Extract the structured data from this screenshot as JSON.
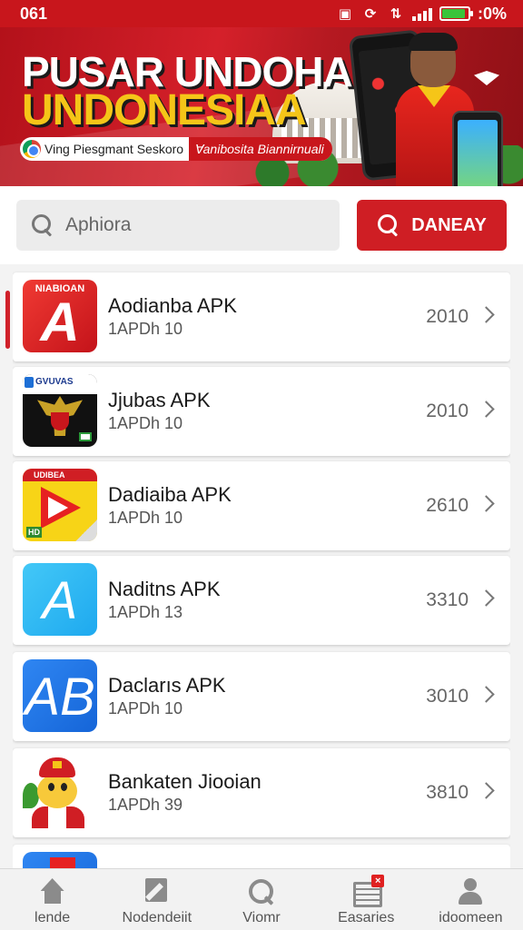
{
  "colors": {
    "brand_red": "#c8161c",
    "button_red": "#cf1e24",
    "battery_green": "#3ac43a",
    "banner_title_yellow": "#f5c518"
  },
  "status_bar": {
    "time": "061",
    "battery_text": ":0%",
    "battery_level": 0.9,
    "icons": [
      "notification-icon",
      "sync-icon",
      "data-icon",
      "signal-icon",
      "battery-icon"
    ]
  },
  "banner": {
    "title_line1": "PUSAR UNDOHAN",
    "title_line2": "UNDONESIAA",
    "subtitle_left": "Ving Piesgmant Seskoro",
    "subtitle_right": "ꓯanibosita Biannirnuali"
  },
  "search": {
    "placeholder": "Aphiora",
    "button_label": "DANEAY"
  },
  "apps": [
    {
      "name": "Aodianba APK",
      "meta": "1APDh 10",
      "size": "2010",
      "icon": "red-a-icon",
      "icon_title": "NIABIOAN",
      "glyph": "A"
    },
    {
      "name": "Jjubas APK",
      "meta": "1APDh 10",
      "size": "2010",
      "icon": "eagle-emblem-icon",
      "icon_title": "GVUVAS"
    },
    {
      "name": "Dadiaiba APK",
      "meta": "1APDh 10",
      "size": "2610",
      "icon": "play-icon",
      "icon_title": "UDIBEA",
      "icon_badge": "HD"
    },
    {
      "name": "Naditns APK",
      "meta": "1APDh 13",
      "size": "3310",
      "icon": "cyan-a-icon",
      "glyph": "A"
    },
    {
      "name": "Daclarıs APK",
      "meta": "1APDh 10",
      "size": "3010",
      "icon": "blue-ab-icon",
      "glyph": "AB"
    },
    {
      "name": "Bankaten Jiooian",
      "meta": "1APDh 39",
      "size": "3810",
      "icon": "mascot-icon"
    }
  ],
  "bottom_nav": [
    {
      "label": "lende",
      "icon": "home-icon"
    },
    {
      "label": "Nodendeiit",
      "icon": "edit-icon"
    },
    {
      "label": "Viomr",
      "icon": "search-icon"
    },
    {
      "label": "Easaries",
      "icon": "news-icon",
      "badge": "×"
    },
    {
      "label": "idoomeen",
      "icon": "user-icon"
    }
  ]
}
